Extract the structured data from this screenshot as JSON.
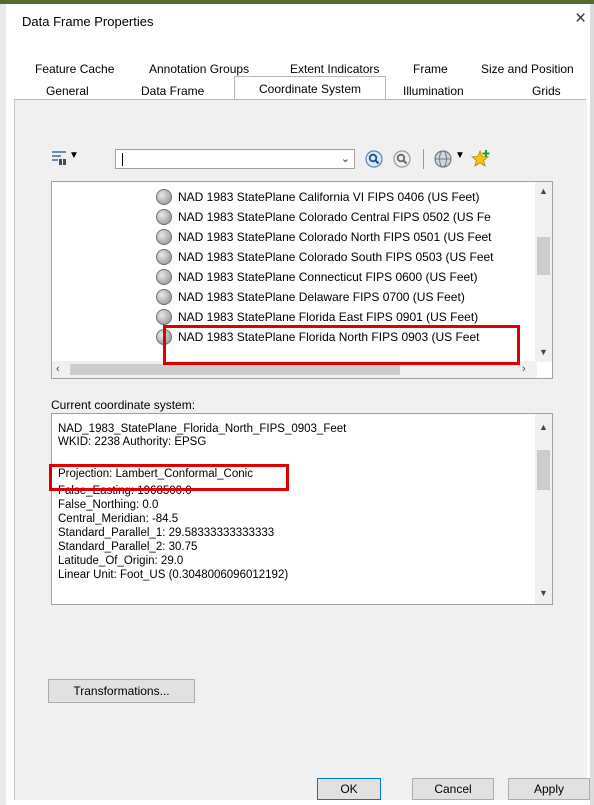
{
  "window": {
    "title": "Data Frame Properties",
    "close_glyph": "×"
  },
  "tabs": {
    "row1": [
      "Feature Cache",
      "Annotation Groups",
      "Extent Indicators",
      "Frame",
      "Size and Position"
    ],
    "row2": [
      "General",
      "Data Frame",
      "Coordinate System",
      "Illumination",
      "Grids"
    ],
    "active": "Coordinate System"
  },
  "toolbar": {
    "filter_icon": "filter-icon",
    "search_value": "",
    "icons": [
      "search-icon",
      "clear-search-icon",
      "globe-icon",
      "add-favorite-icon"
    ]
  },
  "coordinate_list": {
    "items": [
      "NAD 1983 StatePlane California VI FIPS 0406 (US Feet)",
      "NAD 1983 StatePlane Colorado Central FIPS 0502 (US Fe",
      "NAD 1983 StatePlane Colorado North FIPS 0501 (US Feet",
      "NAD 1983 StatePlane Colorado South FIPS 0503 (US Feet",
      "NAD 1983 StatePlane Connecticut FIPS 0600 (US Feet)",
      "NAD 1983 StatePlane Delaware FIPS 0700 (US Feet)",
      "NAD 1983 StatePlane Florida East FIPS 0901 (US Feet)",
      "NAD 1983 StatePlane Florida North FIPS 0903 (US Feet"
    ],
    "selected": "NAD 1983 StatePlane Florida North FIPS 0903 (US Feet"
  },
  "current": {
    "label": "Current coordinate system:",
    "lines": [
      "NAD_1983_StatePlane_Florida_North_FIPS_0903_Feet",
      "WKID: 2238 Authority: EPSG",
      "",
      "Projection: Lambert_Conformal_Conic",
      "False_Easting: 1968500.0",
      "False_Northing: 0.0",
      "Central_Meridian: -84.5",
      "Standard_Parallel_1: 29.58333333333333",
      "Standard_Parallel_2: 30.75",
      "Latitude_Of_Origin: 29.0",
      "Linear Unit: Foot_US (0.3048006096012192)"
    ]
  },
  "buttons": {
    "transformations": "Transformations...",
    "ok": "OK",
    "cancel": "Cancel",
    "apply": "Apply"
  },
  "colors": {
    "highlight": "#e00000",
    "accent_rule": "#556b2f"
  }
}
